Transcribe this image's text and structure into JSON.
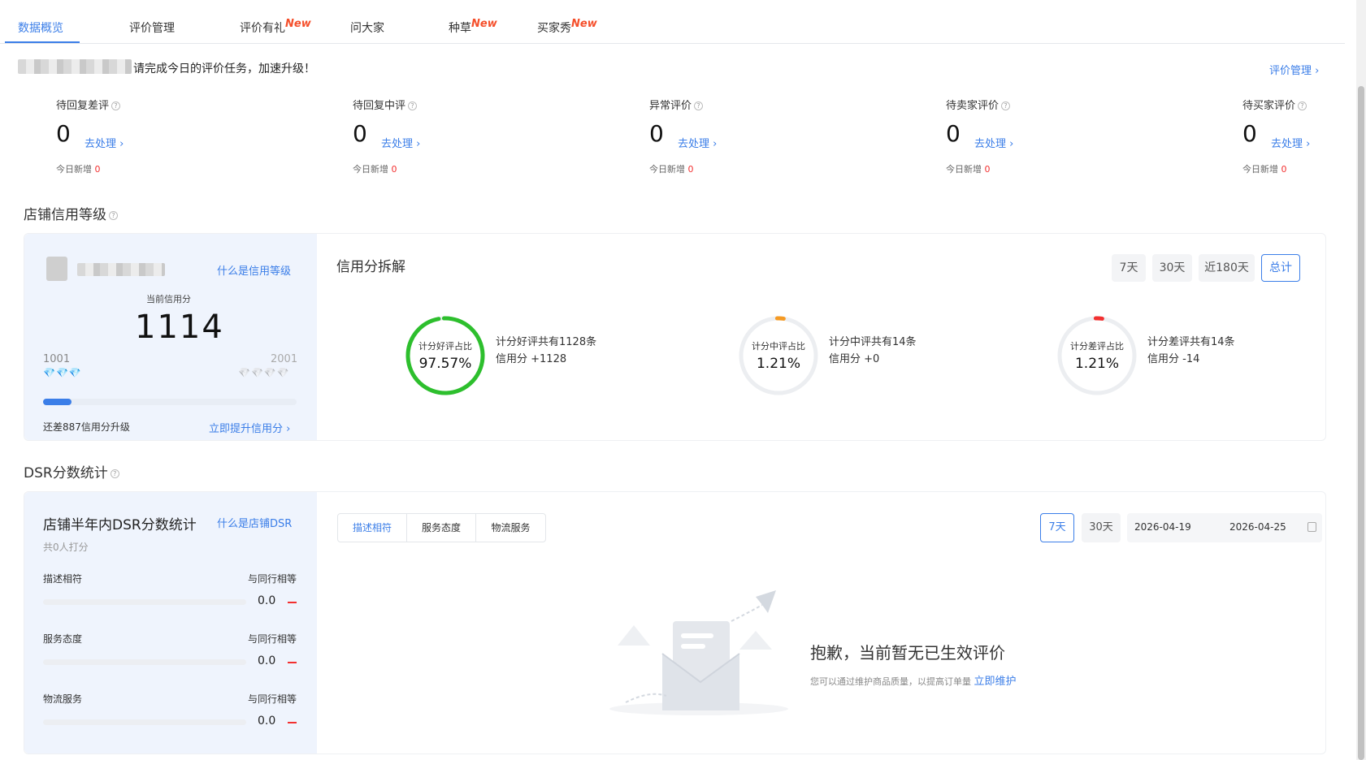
{
  "tabs": [
    {
      "label": "数据概览",
      "new": ""
    },
    {
      "label": "评价管理",
      "new": ""
    },
    {
      "label": "评价有礼",
      "new": "New"
    },
    {
      "label": "问大家",
      "new": ""
    },
    {
      "label": "种草",
      "new": "New"
    },
    {
      "label": "买家秀",
      "new": "New"
    }
  ],
  "banner": {
    "text": "请完成今日的评价任务，加速升级！",
    "link": "评价管理 ›"
  },
  "stats": [
    {
      "title": "待回复差评",
      "value": "0",
      "link": "去处理 ›",
      "sub_label": "今日新增",
      "sub_value": "0"
    },
    {
      "title": "待回复中评",
      "value": "0",
      "link": "去处理 ›",
      "sub_label": "今日新增",
      "sub_value": "0"
    },
    {
      "title": "异常评价",
      "value": "0",
      "link": "去处理 ›",
      "sub_label": "今日新增",
      "sub_value": "0"
    },
    {
      "title": "待卖家评价",
      "value": "0",
      "link": "去处理 ›",
      "sub_label": "今日新增",
      "sub_value": "0"
    },
    {
      "title": "待买家评价",
      "value": "0",
      "link": "去处理 ›",
      "sub_label": "今日新增",
      "sub_value": "0"
    }
  ],
  "credit": {
    "section_title": "店铺信用等级",
    "what_link": "什么是信用等级",
    "current_label": "当前信用分",
    "current_value": "1114",
    "min_label": "1001",
    "max_label": "2001",
    "progress": 0.113,
    "gap_text": "还差887信用分升级",
    "upgrade_link": "立即提升信用分 ›",
    "breakdown_title": "信用分拆解",
    "periods": [
      "7天",
      "30天",
      "近180天",
      "总计"
    ],
    "active_period": "总计",
    "rings": [
      {
        "label": "计分好评占比",
        "value": "97.57%",
        "fraction": 0.9757,
        "color": "#2dbf2d",
        "desc1": "计分好评共有1128条",
        "desc2": "信用分 +1128"
      },
      {
        "label": "计分中评占比",
        "value": "1.21%",
        "fraction": 0.0121,
        "color": "#f59a23",
        "desc1": "计分中评共有14条",
        "desc2": "信用分 +0"
      },
      {
        "label": "计分差评占比",
        "value": "1.21%",
        "fraction": 0.0121,
        "color": "#f23030",
        "desc1": "计分差评共有14条",
        "desc2": "信用分 -14"
      }
    ]
  },
  "dsr": {
    "section_title": "DSR分数统计",
    "card_title": "店铺半年内DSR分数统计",
    "what_link": "什么是店铺DSR",
    "raters": "共0人打分",
    "rows": [
      {
        "label": "描述相符",
        "compare": "与同行相等",
        "value": "0.0"
      },
      {
        "label": "服务态度",
        "compare": "与同行相等",
        "value": "0.0"
      },
      {
        "label": "物流服务",
        "compare": "与同行相等",
        "value": "0.0"
      }
    ],
    "tabs": [
      "描述相符",
      "服务态度",
      "物流服务"
    ],
    "periods": [
      "7天",
      "30天"
    ],
    "date_start": "2026-04-19",
    "date_end": "2026-04-25",
    "empty_title": "抱歉，当前暂无已生效评价",
    "empty_desc": "您可以通过维护商品质量，以提高订单量",
    "empty_link": "立即维护"
  }
}
